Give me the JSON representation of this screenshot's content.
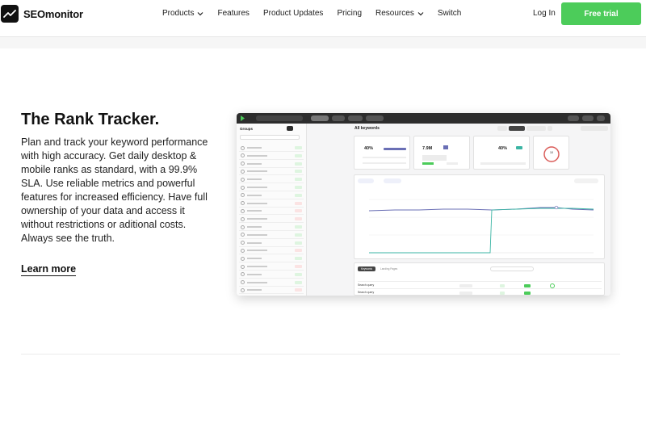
{
  "nav": {
    "logo_text": "SEOmonitor",
    "menu": [
      {
        "label": "Products",
        "dropdown": true
      },
      {
        "label": "Features",
        "dropdown": false
      },
      {
        "label": "Product Updates",
        "dropdown": false
      },
      {
        "label": "Pricing",
        "dropdown": false
      },
      {
        "label": "Resources",
        "dropdown": true
      },
      {
        "label": "Switch",
        "dropdown": false
      }
    ],
    "login_label": "Log In",
    "cta_label": "Free trial"
  },
  "hero": {
    "title": "The Rank Tracker.",
    "description": "Plan and track your keyword performance with high accuracy. Get daily desktop & mobile ranks as standard, with a 99.9% SLA. Use reliable metrics and powerful features for increased efficiency. Have full ownership of your data and access it without restrictions or aditional costs. Always see the truth.",
    "learn_more": "Learn more"
  },
  "app_mockup": {
    "sidebar_title": "Groups",
    "main_title": "All keywords",
    "cards": [
      {
        "value": "40%"
      },
      {
        "value": "7.9M"
      },
      {
        "value": "40%"
      },
      {
        "value": "10"
      }
    ],
    "table_tabs": [
      "Keywords",
      "Landing Pages"
    ],
    "rows": [
      "Search query",
      "Search query"
    ],
    "colors": {
      "accent_green": "#4ccc5a",
      "chart_blue": "#6a6fb5",
      "chart_teal": "#3bb5a4",
      "ring_red": "#d9534f",
      "dark_bar": "#2d2d2d"
    }
  }
}
